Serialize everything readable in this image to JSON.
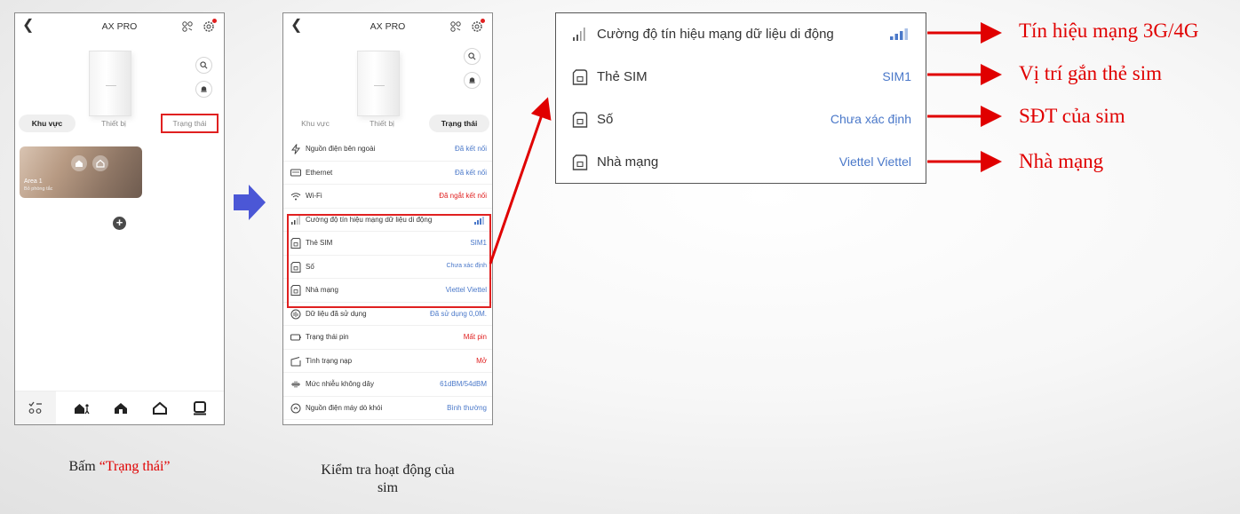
{
  "colors": {
    "accent_red": "#e02020",
    "link_blue": "#4a78c9",
    "annotation_red": "#e00000",
    "arrow_blue": "#4b57d6"
  },
  "app": {
    "title": "AX PRO",
    "back_icon": "chevron-left-icon",
    "share_icon": "share-icon",
    "settings_icon": "gear-icon"
  },
  "phone1": {
    "tabs": [
      "Khu vực",
      "Thiết bị",
      "Trạng thái"
    ],
    "area": {
      "name": "Area 1",
      "mode": "Bỏ phòng tắc"
    },
    "add_icon": "plus-icon"
  },
  "phone2": {
    "tabs": [
      "Khu vực",
      "Thiết bị",
      "Trạng thái"
    ],
    "status_rows": [
      {
        "label": "Nguồn điện bên ngoài",
        "value": "Đã kết nối",
        "value_color": "blue",
        "icon": "power-bolt-icon"
      },
      {
        "label": "Ethernet",
        "value": "Đã kết nối",
        "value_color": "blue",
        "icon": "ethernet-icon"
      },
      {
        "label": "Wi-Fi",
        "value": "Đã ngắt kết nối",
        "value_color": "red",
        "icon": "wifi-icon"
      },
      {
        "label": "Cường độ tín hiệu mạng dữ liệu di động",
        "value": "",
        "value_color": "blue",
        "icon": "signal-icon"
      },
      {
        "label": "Thẻ SIM",
        "value": "SIM1",
        "value_color": "blue",
        "icon": "sim-icon"
      },
      {
        "label": "Số",
        "value": "Chưa xác định",
        "value_color": "blue",
        "icon": "sim-icon"
      },
      {
        "label": "Nhà mạng",
        "value": "Viettel Viettel",
        "value_color": "blue",
        "icon": "sim-icon"
      },
      {
        "label": "Dữ liệu đã sử dụng",
        "value": "Đã sử dụng 0,0M.",
        "value_color": "blue",
        "icon": "data-usage-icon"
      },
      {
        "label": "Trạng thái pin",
        "value": "Mất pin",
        "value_color": "red",
        "icon": "battery-icon"
      },
      {
        "label": "Tình trạng nạp",
        "value": "Mở",
        "value_color": "red",
        "icon": "lid-icon"
      },
      {
        "label": "Mức nhiễu không dây",
        "value": "61dBM/54dBM",
        "value_color": "blue",
        "icon": "wireless-noise-icon"
      },
      {
        "label": "Nguồn điện máy dò khói",
        "value": "Bình thường",
        "value_color": "blue",
        "icon": "smoke-detector-icon"
      }
    ]
  },
  "zoom": {
    "rows": [
      {
        "label": "Cường độ tín hiệu mạng dữ liệu di động",
        "value": "",
        "icon": "signal-icon"
      },
      {
        "label": "Thẻ SIM",
        "value": "SIM1",
        "icon": "sim-icon"
      },
      {
        "label": "Số",
        "value": "Chưa xác định",
        "icon": "sim-icon"
      },
      {
        "label": "Nhà mạng",
        "value": "Viettel Viettel",
        "icon": "sim-icon"
      }
    ]
  },
  "annotations": [
    "Tín hiệu mạng 3G/4G",
    "Vị trí gắn thẻ sim",
    "SĐT của sim",
    "Nhà mạng"
  ],
  "captions": {
    "left_prefix": "Bấm ",
    "left_highlight": "“Trạng thái”",
    "middle_line1": "Kiểm tra hoạt động của",
    "middle_line2": "sim"
  }
}
